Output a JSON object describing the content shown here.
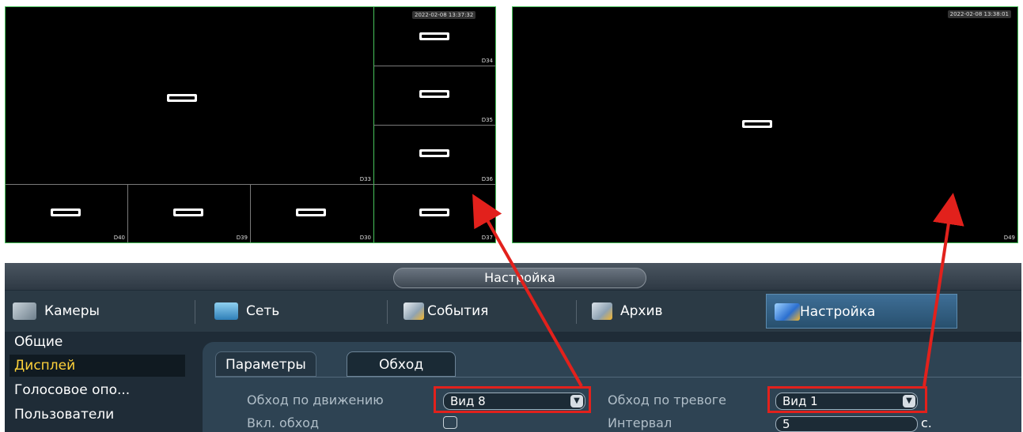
{
  "screen_left": {
    "timestamp": "2022-02-08 13:37:32",
    "channels": {
      "main": "D33",
      "r1": "D34",
      "r2": "D35",
      "r3": "D36",
      "b1": "D40",
      "b2": "D39",
      "b3": "D30",
      "b4": "D37"
    }
  },
  "screen_right": {
    "timestamp": "2022-02-08 13:38:01",
    "channel": "D49"
  },
  "window": {
    "title": "Настройка"
  },
  "tabs": [
    {
      "label": "Камеры",
      "icon": "camera-icon"
    },
    {
      "label": "Сеть",
      "icon": "network-icon"
    },
    {
      "label": "События",
      "icon": "events-icon"
    },
    {
      "label": "Архив",
      "icon": "archive-icon"
    },
    {
      "label": "Настройка",
      "icon": "settings-icon"
    }
  ],
  "sidebar": {
    "items": [
      {
        "label": "Общие"
      },
      {
        "label": "Дисплей"
      },
      {
        "label": "Голосовое опо..."
      },
      {
        "label": "Пользователи"
      }
    ]
  },
  "subtabs": {
    "params": "Параметры",
    "tour": "Обход"
  },
  "form": {
    "motion_tour_label": "Обход по движению",
    "motion_tour_value": "Вид 8",
    "alarm_tour_label": "Обход по тревоге",
    "alarm_tour_value": "Вид 1",
    "enable_tour_label": "Вкл. обход",
    "interval_label": "Интервал",
    "interval_value": "5",
    "interval_unit": "с."
  },
  "colors": {
    "panel_bg": "#1f2c37",
    "active_tab": "#3e6e96",
    "highlight": "#e2211c",
    "active_side": "#ffd23a"
  }
}
